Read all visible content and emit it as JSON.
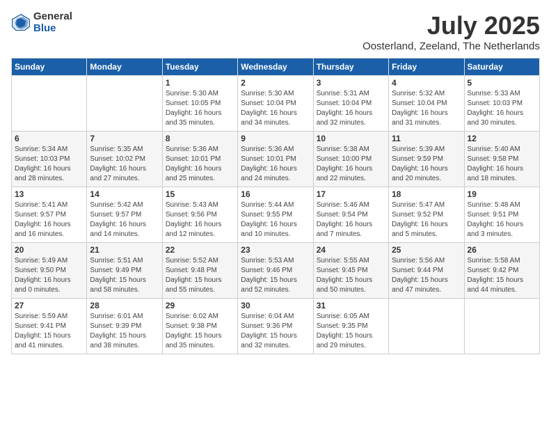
{
  "logo": {
    "general": "General",
    "blue": "Blue"
  },
  "title": "July 2025",
  "subtitle": "Oosterland, Zeeland, The Netherlands",
  "days_of_week": [
    "Sunday",
    "Monday",
    "Tuesday",
    "Wednesday",
    "Thursday",
    "Friday",
    "Saturday"
  ],
  "weeks": [
    [
      {
        "day": "",
        "info": ""
      },
      {
        "day": "",
        "info": ""
      },
      {
        "day": "1",
        "info": "Sunrise: 5:30 AM\nSunset: 10:05 PM\nDaylight: 16 hours\nand 35 minutes."
      },
      {
        "day": "2",
        "info": "Sunrise: 5:30 AM\nSunset: 10:04 PM\nDaylight: 16 hours\nand 34 minutes."
      },
      {
        "day": "3",
        "info": "Sunrise: 5:31 AM\nSunset: 10:04 PM\nDaylight: 16 hours\nand 32 minutes."
      },
      {
        "day": "4",
        "info": "Sunrise: 5:32 AM\nSunset: 10:04 PM\nDaylight: 16 hours\nand 31 minutes."
      },
      {
        "day": "5",
        "info": "Sunrise: 5:33 AM\nSunset: 10:03 PM\nDaylight: 16 hours\nand 30 minutes."
      }
    ],
    [
      {
        "day": "6",
        "info": "Sunrise: 5:34 AM\nSunset: 10:03 PM\nDaylight: 16 hours\nand 28 minutes."
      },
      {
        "day": "7",
        "info": "Sunrise: 5:35 AM\nSunset: 10:02 PM\nDaylight: 16 hours\nand 27 minutes."
      },
      {
        "day": "8",
        "info": "Sunrise: 5:36 AM\nSunset: 10:01 PM\nDaylight: 16 hours\nand 25 minutes."
      },
      {
        "day": "9",
        "info": "Sunrise: 5:36 AM\nSunset: 10:01 PM\nDaylight: 16 hours\nand 24 minutes."
      },
      {
        "day": "10",
        "info": "Sunrise: 5:38 AM\nSunset: 10:00 PM\nDaylight: 16 hours\nand 22 minutes."
      },
      {
        "day": "11",
        "info": "Sunrise: 5:39 AM\nSunset: 9:59 PM\nDaylight: 16 hours\nand 20 minutes."
      },
      {
        "day": "12",
        "info": "Sunrise: 5:40 AM\nSunset: 9:58 PM\nDaylight: 16 hours\nand 18 minutes."
      }
    ],
    [
      {
        "day": "13",
        "info": "Sunrise: 5:41 AM\nSunset: 9:57 PM\nDaylight: 16 hours\nand 16 minutes."
      },
      {
        "day": "14",
        "info": "Sunrise: 5:42 AM\nSunset: 9:57 PM\nDaylight: 16 hours\nand 14 minutes."
      },
      {
        "day": "15",
        "info": "Sunrise: 5:43 AM\nSunset: 9:56 PM\nDaylight: 16 hours\nand 12 minutes."
      },
      {
        "day": "16",
        "info": "Sunrise: 5:44 AM\nSunset: 9:55 PM\nDaylight: 16 hours\nand 10 minutes."
      },
      {
        "day": "17",
        "info": "Sunrise: 5:46 AM\nSunset: 9:54 PM\nDaylight: 16 hours\nand 7 minutes."
      },
      {
        "day": "18",
        "info": "Sunrise: 5:47 AM\nSunset: 9:52 PM\nDaylight: 16 hours\nand 5 minutes."
      },
      {
        "day": "19",
        "info": "Sunrise: 5:48 AM\nSunset: 9:51 PM\nDaylight: 16 hours\nand 3 minutes."
      }
    ],
    [
      {
        "day": "20",
        "info": "Sunrise: 5:49 AM\nSunset: 9:50 PM\nDaylight: 16 hours\nand 0 minutes."
      },
      {
        "day": "21",
        "info": "Sunrise: 5:51 AM\nSunset: 9:49 PM\nDaylight: 15 hours\nand 58 minutes."
      },
      {
        "day": "22",
        "info": "Sunrise: 5:52 AM\nSunset: 9:48 PM\nDaylight: 15 hours\nand 55 minutes."
      },
      {
        "day": "23",
        "info": "Sunrise: 5:53 AM\nSunset: 9:46 PM\nDaylight: 15 hours\nand 52 minutes."
      },
      {
        "day": "24",
        "info": "Sunrise: 5:55 AM\nSunset: 9:45 PM\nDaylight: 15 hours\nand 50 minutes."
      },
      {
        "day": "25",
        "info": "Sunrise: 5:56 AM\nSunset: 9:44 PM\nDaylight: 15 hours\nand 47 minutes."
      },
      {
        "day": "26",
        "info": "Sunrise: 5:58 AM\nSunset: 9:42 PM\nDaylight: 15 hours\nand 44 minutes."
      }
    ],
    [
      {
        "day": "27",
        "info": "Sunrise: 5:59 AM\nSunset: 9:41 PM\nDaylight: 15 hours\nand 41 minutes."
      },
      {
        "day": "28",
        "info": "Sunrise: 6:01 AM\nSunset: 9:39 PM\nDaylight: 15 hours\nand 38 minutes."
      },
      {
        "day": "29",
        "info": "Sunrise: 6:02 AM\nSunset: 9:38 PM\nDaylight: 15 hours\nand 35 minutes."
      },
      {
        "day": "30",
        "info": "Sunrise: 6:04 AM\nSunset: 9:36 PM\nDaylight: 15 hours\nand 32 minutes."
      },
      {
        "day": "31",
        "info": "Sunrise: 6:05 AM\nSunset: 9:35 PM\nDaylight: 15 hours\nand 29 minutes."
      },
      {
        "day": "",
        "info": ""
      },
      {
        "day": "",
        "info": ""
      }
    ]
  ]
}
